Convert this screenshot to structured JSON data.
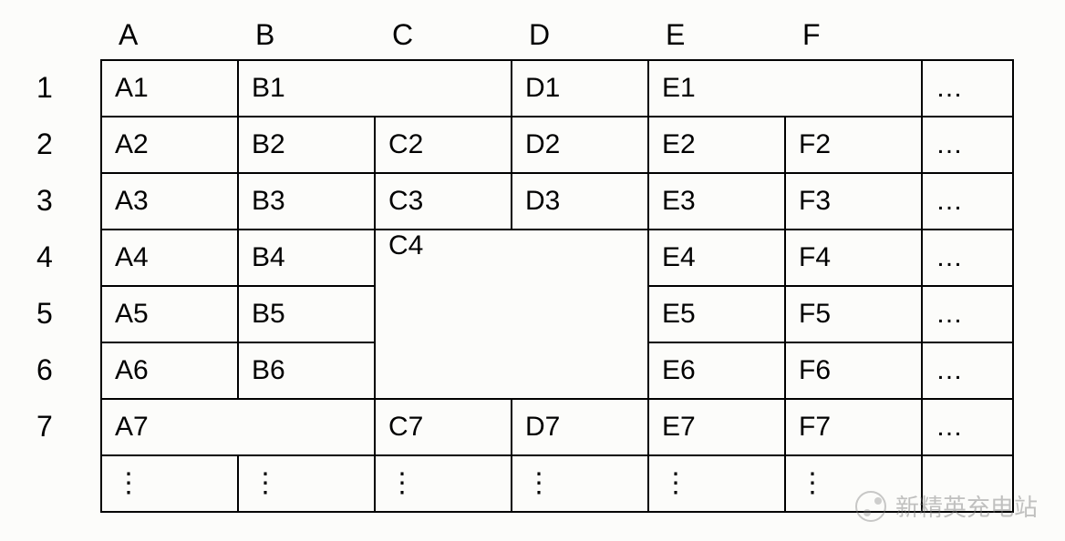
{
  "columns": [
    "A",
    "B",
    "C",
    "D",
    "E",
    "F"
  ],
  "rows": [
    "1",
    "2",
    "3",
    "4",
    "5",
    "6",
    "7"
  ],
  "ellipsis_h": "…",
  "ellipsis_v": "⋮",
  "cells": {
    "r1": {
      "A": "A1",
      "B": "B1",
      "D": "D1",
      "E": "E1"
    },
    "r2": {
      "A": "A2",
      "B": "B2",
      "C": "C2",
      "D": "D2",
      "E": "E2",
      "F": "F2"
    },
    "r3": {
      "A": "A3",
      "B": "B3",
      "C": "C3",
      "D": "D3",
      "E": "E3",
      "F": "F3"
    },
    "r4": {
      "A": "A4",
      "B": "B4",
      "C": "C4",
      "E": "E4",
      "F": "F4"
    },
    "r5": {
      "A": "A5",
      "B": "B5",
      "E": "E5",
      "F": "F5"
    },
    "r6": {
      "A": "A6",
      "B": "B6",
      "E": "E6",
      "F": "F6"
    },
    "r7": {
      "A": "A7",
      "C": "C7",
      "D": "D7",
      "E": "E7",
      "F": "F7"
    }
  },
  "watermark": "新精英充电站"
}
